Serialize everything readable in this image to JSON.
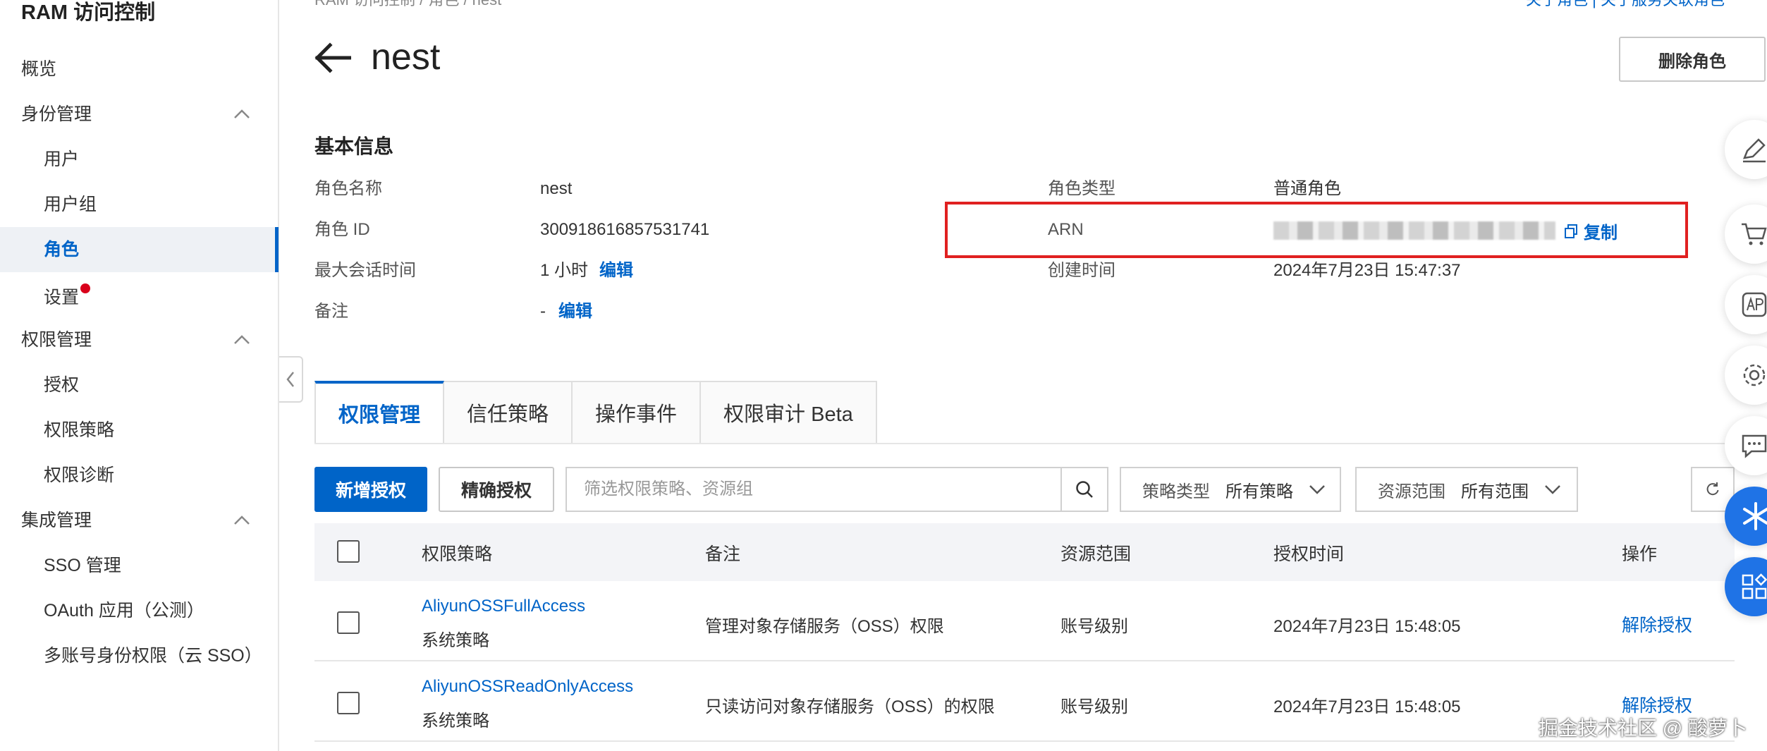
{
  "sidebar": {
    "title": "RAM 访问控制",
    "overview": "概览",
    "identity_group": "身份管理",
    "users": "用户",
    "user_groups": "用户组",
    "roles": "角色",
    "settings": "设置",
    "permission_group": "权限管理",
    "authorization": "授权",
    "policies": "权限策略",
    "diagnosis": "权限诊断",
    "integration_group": "集成管理",
    "sso": "SSO 管理",
    "oauth": "OAuth 应用（公测）",
    "multi_account": "多账号身份权限（云 SSO）"
  },
  "header": {
    "breadcrumb": "RAM 访问控制 / 角色 / nest",
    "top_links": "关于角色 | 关于服务关联角色",
    "title": "nest",
    "delete_button": "删除角色"
  },
  "basic_info": {
    "title": "基本信息",
    "role_name_label": "角色名称",
    "role_name": "nest",
    "role_id_label": "角色 ID",
    "role_id": "300918616857531741",
    "max_session_label": "最大会话时间",
    "max_session": "1 小时",
    "edit": "编辑",
    "note_label": "备注",
    "note": "-",
    "role_type_label": "角色类型",
    "role_type": "普通角色",
    "arn_label": "ARN",
    "copy": "复制",
    "created_label": "创建时间",
    "created": "2024年7月23日 15:47:37"
  },
  "tabs": [
    "权限管理",
    "信任策略",
    "操作事件",
    "权限审计 Beta"
  ],
  "toolbar": {
    "add_grant": "新增授权",
    "precise_grant": "精确授权",
    "search_placeholder": "筛选权限策略、资源组",
    "policy_type_label": "策略类型",
    "policy_type_value": "所有策略",
    "scope_label": "资源范围",
    "scope_value": "所有范围"
  },
  "table": {
    "columns": [
      "权限策略",
      "备注",
      "资源范围",
      "授权时间",
      "操作"
    ],
    "rows": [
      {
        "policy": "AliyunOSSFullAccess",
        "type": "系统策略",
        "note": "管理对象存储服务（OSS）权限",
        "scope": "账号级别",
        "time": "2024年7月23日 15:48:05",
        "action": "解除授权"
      },
      {
        "policy": "AliyunOSSReadOnlyAccess",
        "type": "系统策略",
        "note": "只读访问对象存储服务（OSS）的权限",
        "scope": "账号级别",
        "time": "2024年7月23日 15:48:05",
        "action": "解除授权"
      }
    ]
  },
  "watermark": "掘金技术社区 @ 酸萝卜",
  "colors": {
    "primary": "#0064c8",
    "highlight_box": "#e02020",
    "notify_dot": "#d9001b"
  }
}
